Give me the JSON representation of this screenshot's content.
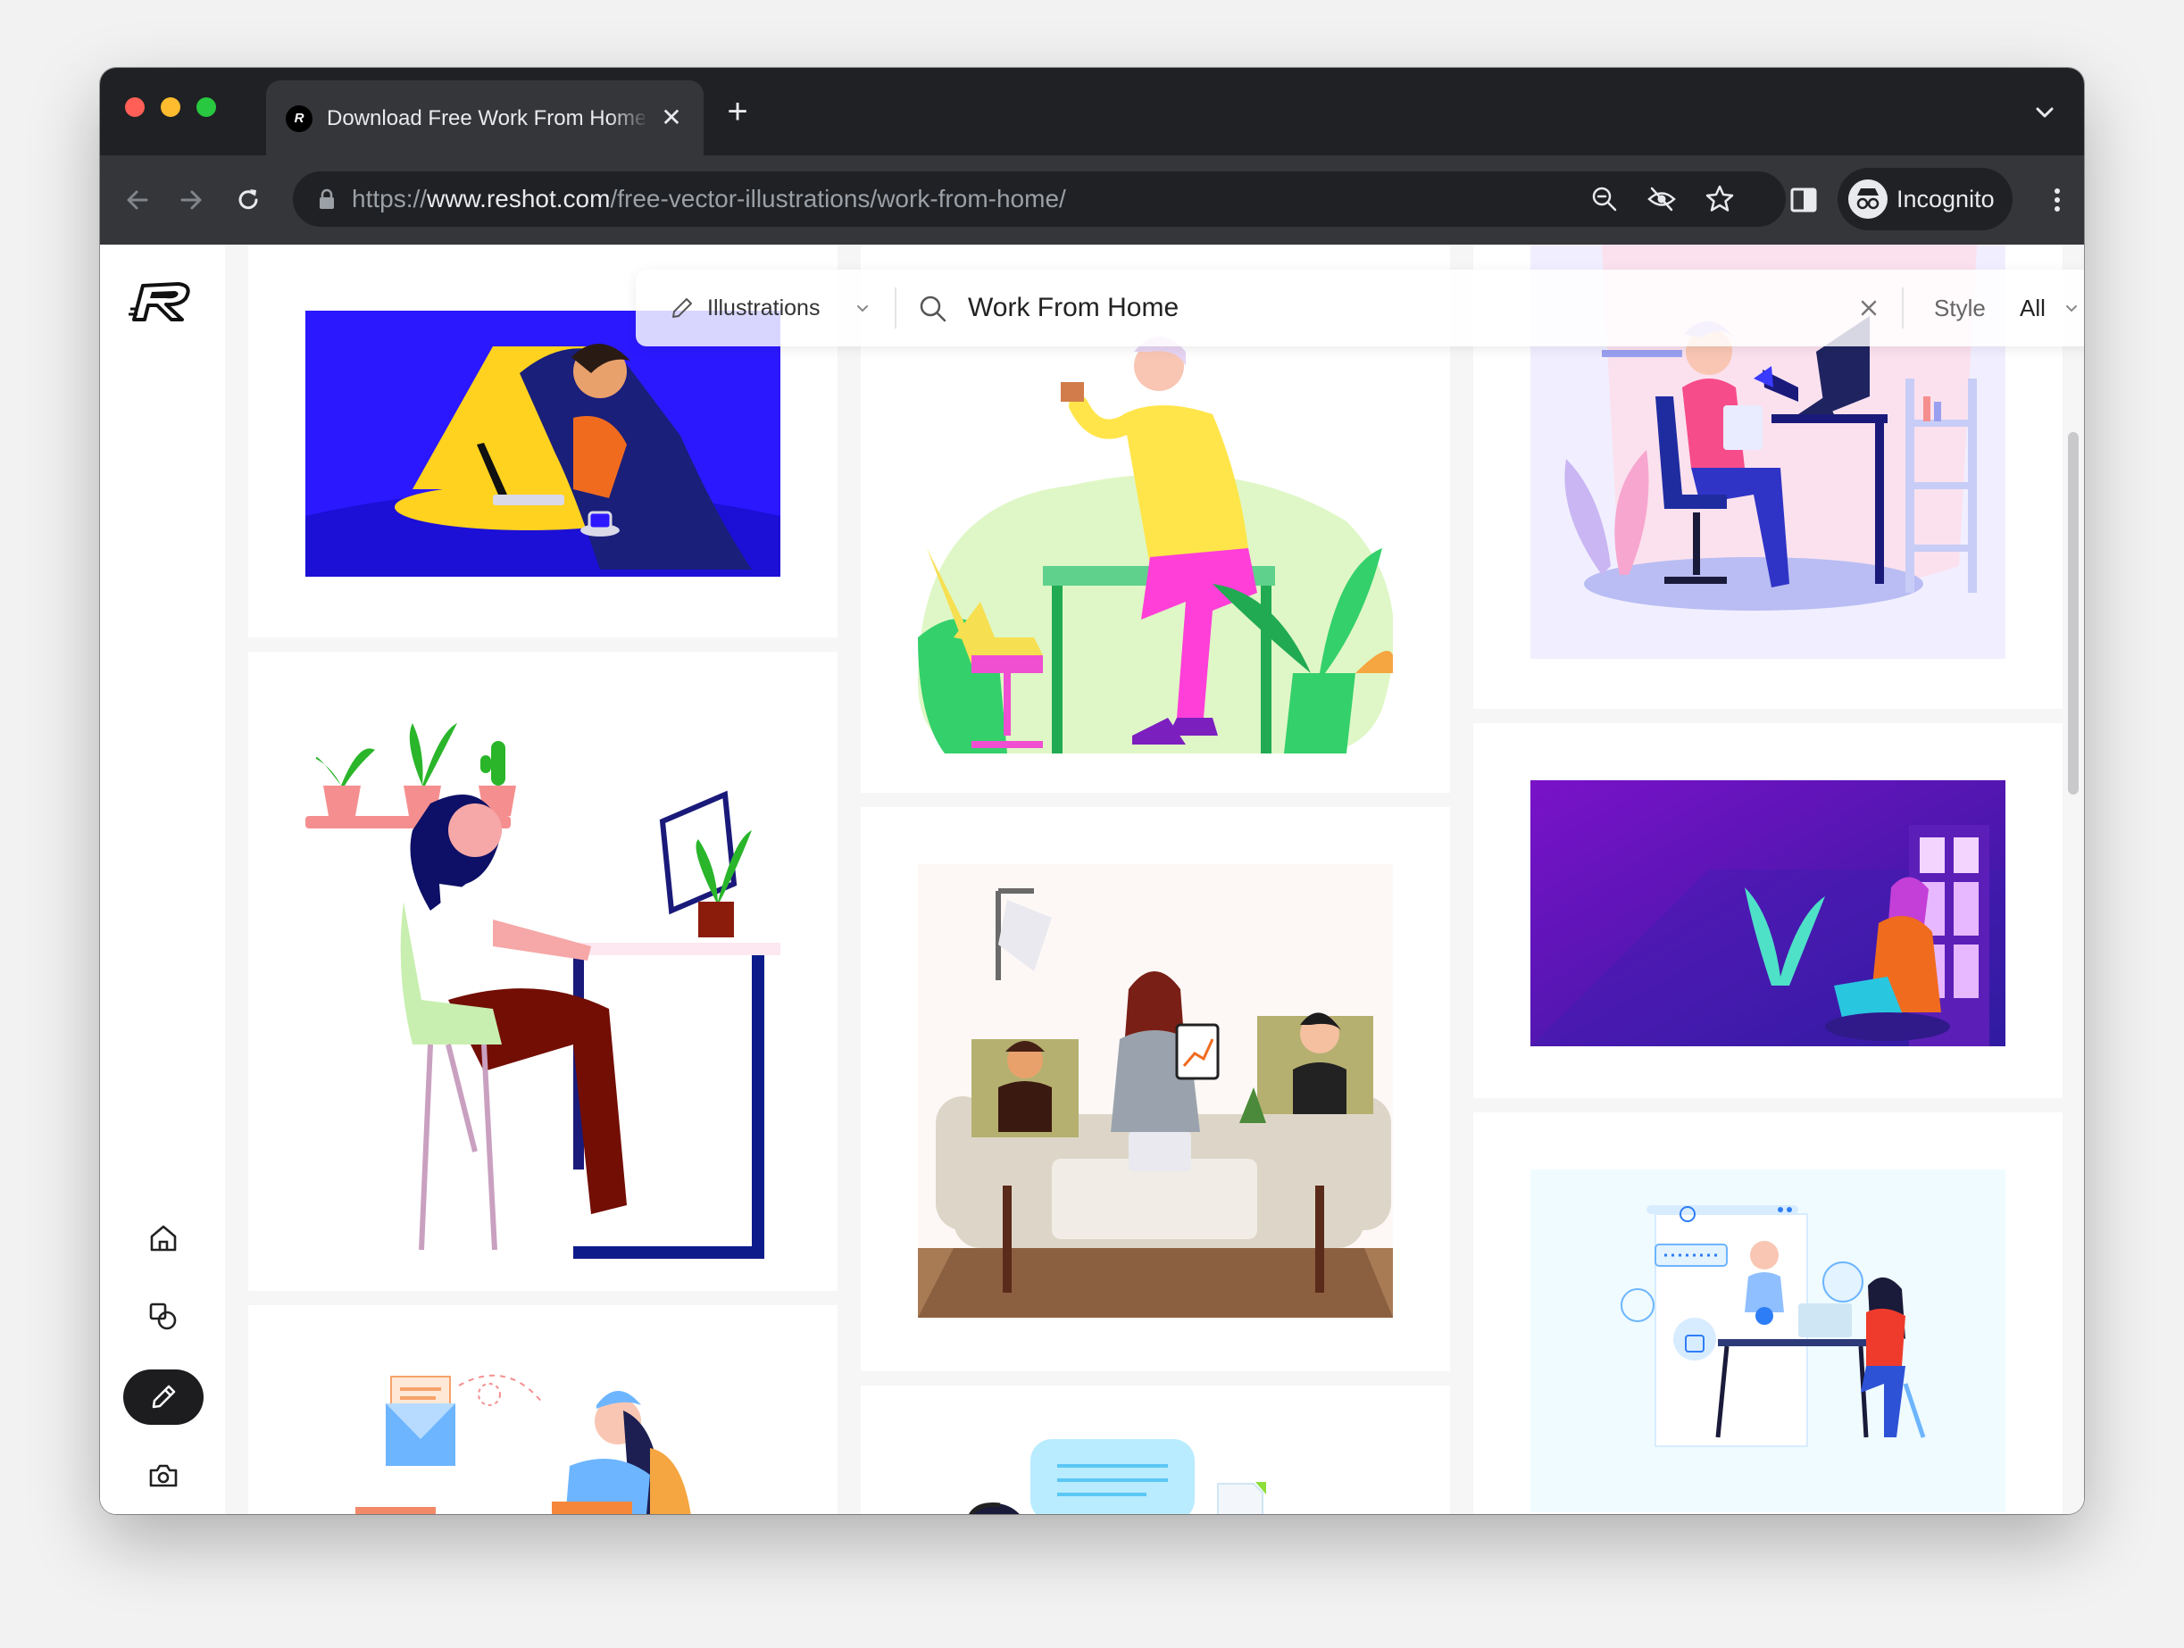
{
  "browser": {
    "tab_title": "Download Free Work From Home Vector Illustrations",
    "url_scheme": "https://",
    "url_host": "www.reshot.com",
    "url_path": "/free-vector-illustrations/work-from-home/",
    "profile_label": "Incognito",
    "new_tab_symbol": "+",
    "tab_close_symbol": "✕",
    "colors": {
      "tabbar": "#202124",
      "toolbar": "#35363a",
      "text": "#e8eaed",
      "close_light": "#ff5f57",
      "minimize_light": "#febc2e",
      "zoom_light": "#28c840"
    }
  },
  "site": {
    "logo_icon": "reshot-logo-icon",
    "nav": [
      {
        "name": "home-icon",
        "active": false
      },
      {
        "name": "shapes-icon",
        "active": false
      },
      {
        "name": "pencil-icon",
        "active": true
      },
      {
        "name": "camera-icon",
        "active": false
      }
    ]
  },
  "search": {
    "type_label": "Illustrations",
    "query": "Work From Home",
    "style_label": "Style",
    "style_value": "All"
  },
  "gallery": {
    "items": [
      {
        "name": "illustration-man-stressed-laptop-night",
        "accent": "#2b18ff"
      },
      {
        "name": "illustration-man-coffee-desk-plants",
        "accent": "#ffe54a"
      },
      {
        "name": "illustration-woman-computer-desk-pink",
        "accent": "#3a3aff"
      },
      {
        "name": "illustration-woman-typing-plants-shelf",
        "accent": "#0d1b8a"
      },
      {
        "name": "illustration-video-call-sofa",
        "accent": "#b5b070"
      },
      {
        "name": "illustration-woman-laptop-purple-night",
        "accent": "#7a12c8"
      },
      {
        "name": "illustration-woman-mail-laptop",
        "accent": "#6db5ff"
      },
      {
        "name": "illustration-support-chat-bubbles",
        "accent": "#5bc7f5"
      },
      {
        "name": "illustration-customer-service-desk",
        "accent": "#2d7df6"
      }
    ]
  }
}
